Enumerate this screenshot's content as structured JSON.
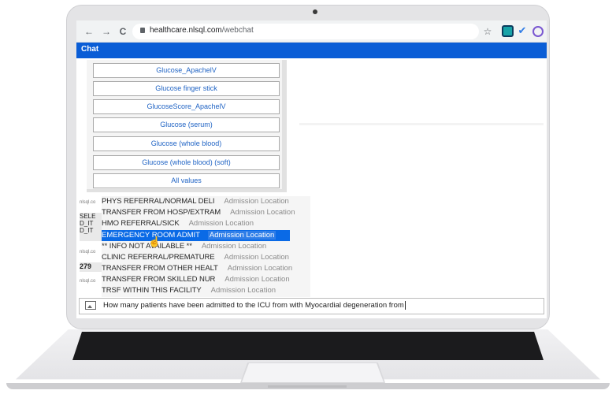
{
  "browser": {
    "url_host": "healthcare.nlsql.com",
    "url_path": "/webchat",
    "nav": {
      "back": "←",
      "forward": "→",
      "reload": "C"
    },
    "star": "☆",
    "extensions": [
      "square-ext-icon",
      "check-ext-icon",
      "circle-ext-icon"
    ]
  },
  "app": {
    "title": "Chat",
    "accent": "#0a5dd6"
  },
  "glucose_options": [
    "Glucose_ApachelV",
    "Glucose finger stick",
    "GlucoseScore_ApachelV",
    "Glucose (serum)",
    "Glucose (whole blood)",
    "Glucose (whole blood) (soft)",
    "All values"
  ],
  "chat_background": {
    "sender_label": "nlsql.co",
    "partial_lines": [
      "SELE",
      "D_IT",
      "D_IT"
    ],
    "count": "279"
  },
  "autocomplete": [
    {
      "name": "PHYS REFERRAL/NORMAL DELI",
      "type": "Admission Location"
    },
    {
      "name": "TRANSFER FROM HOSP/EXTRAM",
      "type": "Admission Location"
    },
    {
      "name": "HMO REFERRAL/SICK",
      "type": "Admission Location"
    },
    {
      "name": "EMERGENCY ROOM ADMIT",
      "type": "Admission Location",
      "selected": true
    },
    {
      "name": "** INFO NOT AVAILABLE **",
      "type": "Admission Location"
    },
    {
      "name": "CLINIC REFERRAL/PREMATURE",
      "type": "Admission Location"
    },
    {
      "name": "TRANSFER FROM OTHER HEALT",
      "type": "Admission Location"
    },
    {
      "name": "TRANSFER FROM SKILLED NUR",
      "type": "Admission Location"
    },
    {
      "name": "TRSF WITHIN THIS FACILITY",
      "type": "Admission Location"
    }
  ],
  "input": {
    "value": "How many patients have been admitted to the ICU from with Myocardial degeneration from"
  }
}
